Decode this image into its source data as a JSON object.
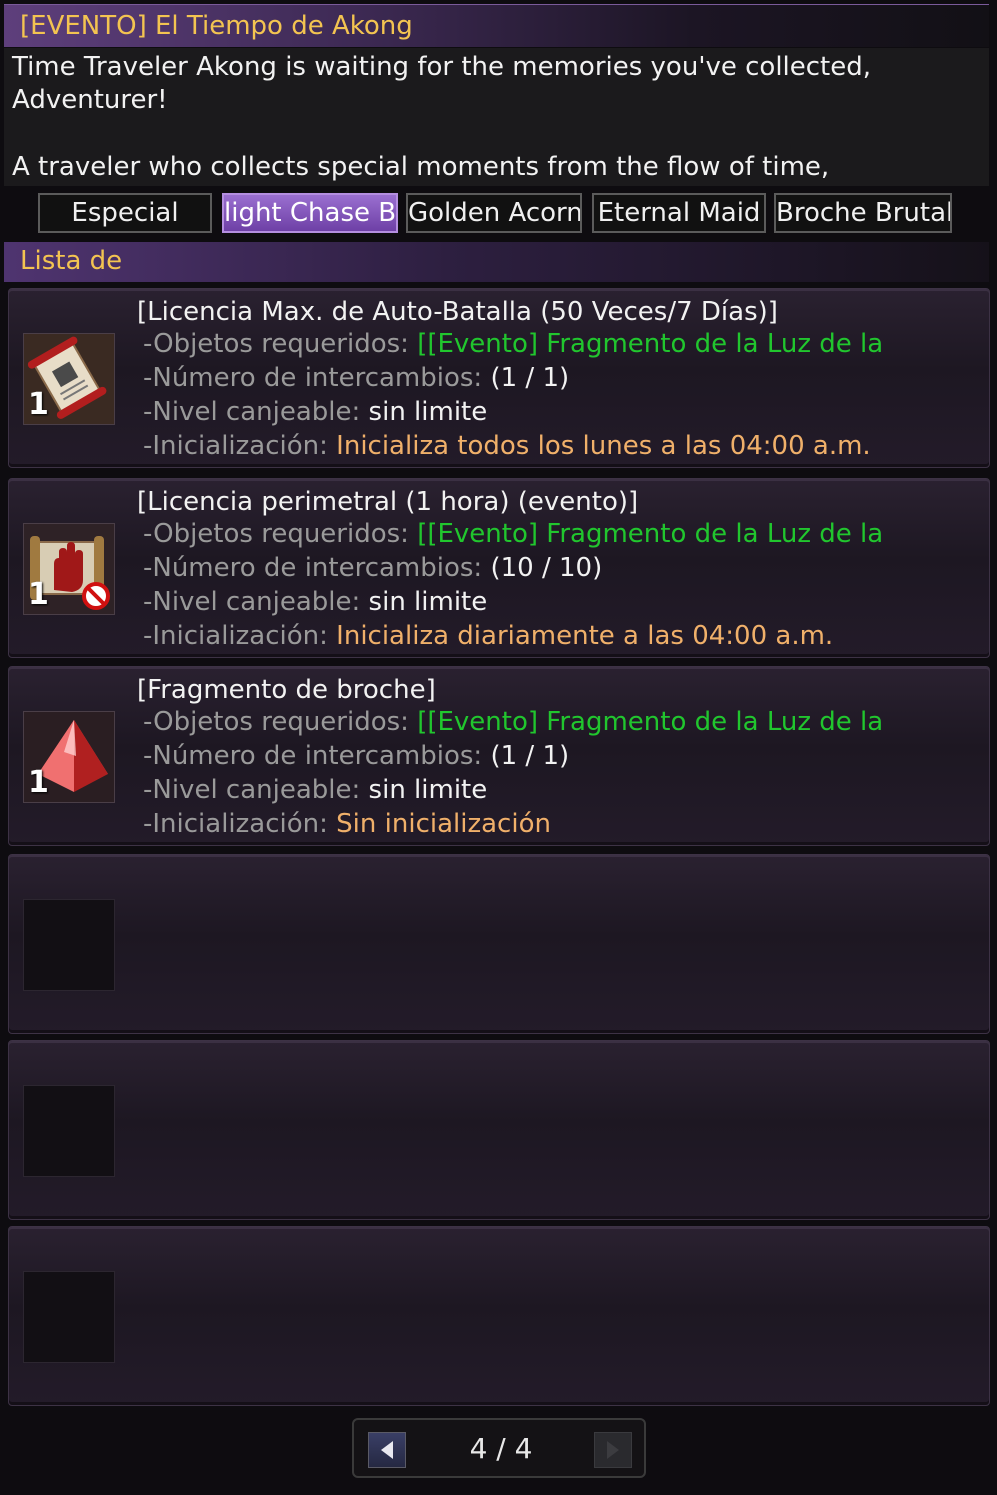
{
  "window": {
    "title": "[EVENTO] El Tiempo de Akong",
    "description": [
      "Time Traveler Akong is waiting for the memories you've collected,",
      "Adventurer!",
      "",
      "A traveler who collects special moments from the flow of time,"
    ]
  },
  "tabs": [
    {
      "label": "Especial",
      "active": false
    },
    {
      "label": "light Chase B",
      "active": true
    },
    {
      "label": "Golden Acorn",
      "active": false
    },
    {
      "label": "Eternal Maid",
      "active": false
    },
    {
      "label": "Broche Brutal",
      "active": false
    }
  ],
  "list": {
    "header": "Lista de",
    "field_labels": {
      "required": "-Objetos requeridos:",
      "exchanges": "-Número de intercambios:",
      "level": "-Nivel canjeable:",
      "reset": "-Inicialización:"
    },
    "items": [
      {
        "name": "[Licencia Max. de  Auto-Batalla (50 Veces/7 Días)]",
        "icon": "scroll-icon",
        "quantity": "1",
        "required": "[[Evento] Fragmento de la Luz de la",
        "exchanges": "(1 / 1)",
        "level": "sin limite",
        "reset": "Inicializa todos los lunes a las 04:00 a.m."
      },
      {
        "name": "[Licencia perimetral (1 hora) (evento)]",
        "icon": "perimeter-scroll-icon",
        "quantity": "1",
        "required": "[[Evento] Fragmento de la Luz de la",
        "exchanges": "(10 / 10)",
        "level": "sin limite",
        "reset": "Inicializa diariamente a las 04:00 a.m."
      },
      {
        "name": "[Fragmento de broche]",
        "icon": "red-gem-icon",
        "quantity": "1",
        "required": "[[Evento] Fragmento de la Luz de la",
        "exchanges": "(1 / 1)",
        "level": "sin limite",
        "reset": "Sin inicialización"
      }
    ],
    "empty_slots": 3
  },
  "pager": {
    "text": "4 / 4",
    "prev_icon": "arrow-left-icon",
    "next_icon": "arrow-right-icon"
  },
  "colors": {
    "title_gold": "#f3c451",
    "required_green": "#21c62e",
    "reset_orange": "#f0b06a",
    "active_tab": "#7a4fb5"
  }
}
